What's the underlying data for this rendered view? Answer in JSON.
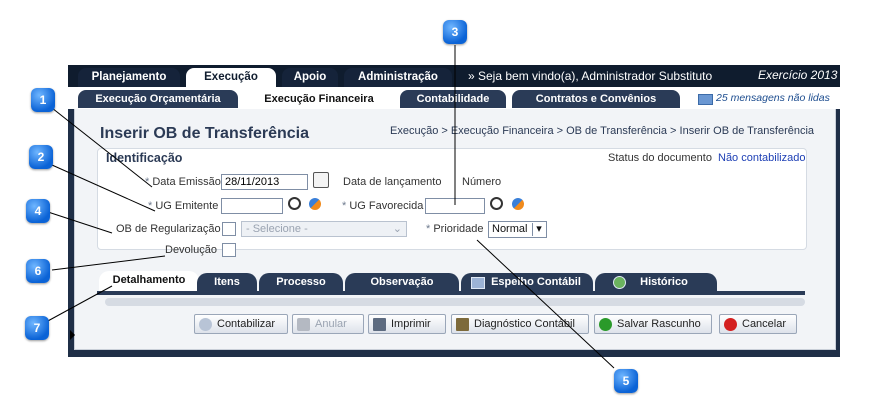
{
  "menu": {
    "tabs": [
      "Planejamento",
      "Execução",
      "Apoio",
      "Administração"
    ],
    "active": "Execução",
    "welcome": "» Seja bem vindo(a), Administrador Substituto",
    "exercicio": "Exercício 2013"
  },
  "submenu": {
    "tabs": [
      "Execução Orçamentária",
      "Execução Financeira",
      "Contabilidade",
      "Contratos e Convênios"
    ],
    "active": "Execução Financeira",
    "messages": "25 mensagens não lidas"
  },
  "page": {
    "title": "Inserir OB de Transferência",
    "breadcrumb": "Execução > Execução Financeira > OB de Transferência > Inserir OB de Transferência"
  },
  "identificacao": {
    "title": "Identificação",
    "status_label": "Status do documento",
    "status_value": "Não contabilizado",
    "data_emissao_label": "Data Emissão",
    "data_emissao_value": "28/11/2013",
    "data_lancamento_label": "Data de lançamento",
    "numero_label": "Número",
    "ug_emitente_label": "UG Emitente",
    "ug_favorecida_label": "UG Favorecida",
    "ob_regularizacao_label": "OB de Regularização",
    "select_placeholder": "- Selecione -",
    "prioridade_label": "Prioridade",
    "prioridade_value": "Normal",
    "devolucao_label": "Devolução",
    "required_mark": "*"
  },
  "detail_tabs": [
    "Detalhamento",
    "Itens",
    "Processo",
    "Observação",
    "Espelho Contábil",
    "Histórico"
  ],
  "buttons": {
    "contabilizar": "Contabilizar",
    "anular": "Anular",
    "imprimir": "Imprimir",
    "diagnostico": "Diagnóstico Contábil",
    "salvar": "Salvar Rascunho",
    "cancelar": "Cancelar"
  },
  "callouts": [
    "1",
    "2",
    "3",
    "4",
    "5",
    "6",
    "7"
  ],
  "colors": {
    "accent": "#0b63d6",
    "nav_dark": "#0f1c2e",
    "link": "#1d3fb5",
    "cancel_red": "#d42020",
    "save_green": "#2a9a2a"
  }
}
